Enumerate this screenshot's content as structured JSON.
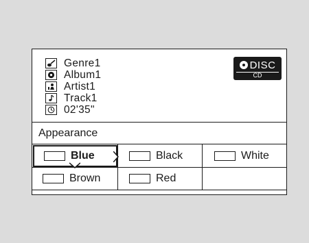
{
  "track_info": {
    "genre": "Genre1",
    "album": "Album1",
    "artist": "Artist1",
    "track": "Track1",
    "time": "02'35\""
  },
  "source_badge": {
    "label": "DISC",
    "sub_label": "CD"
  },
  "section": {
    "heading": "Appearance"
  },
  "options": [
    {
      "label": "Blue",
      "selected": true
    },
    {
      "label": "Black",
      "selected": false
    },
    {
      "label": "White",
      "selected": false
    },
    {
      "label": "Brown",
      "selected": false
    },
    {
      "label": "Red",
      "selected": false
    }
  ],
  "icons": {
    "genre": "guitar-icon",
    "album": "disc-icon",
    "artist": "person-icon",
    "track": "music-note-icon",
    "time": "clock-icon"
  }
}
